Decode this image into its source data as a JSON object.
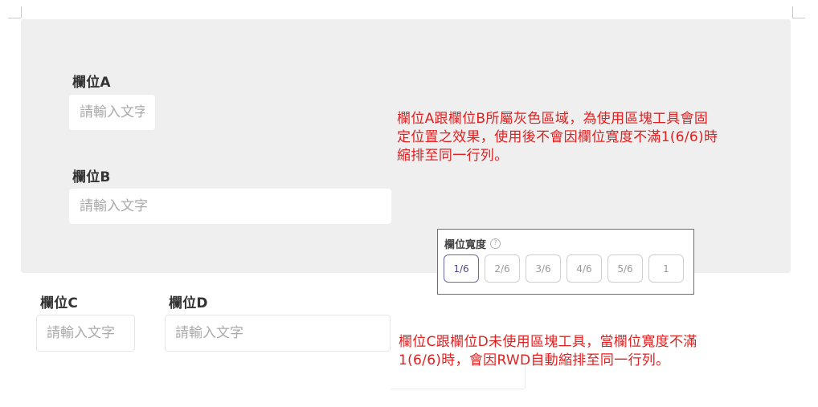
{
  "fields": {
    "a": {
      "label": "欄位A",
      "placeholder": "請輸入文字"
    },
    "b": {
      "label": "欄位B",
      "placeholder": "請輸入文字"
    },
    "c": {
      "label": "欄位C",
      "placeholder": "請輸入文字"
    },
    "d": {
      "label": "欄位D",
      "placeholder": "請輸入文字"
    }
  },
  "annotations": {
    "top": {
      "line1": "欄位A跟欄位B所屬灰色區域，為使用區塊工具會固",
      "line2": "定位置之效果，使用後不會因欄位寬度不滿1(6/6)時",
      "line3": "縮排至同一行列。"
    },
    "bottom": {
      "line1": "欄位C跟欄位D未使用區塊工具，當欄位寬度不滿",
      "line2": "1(6/6)時，會因RWD自動縮排至同一行列。"
    }
  },
  "width_panel": {
    "title": "欄位寬度",
    "help_icon": "question-circle-icon",
    "options": [
      "1/6",
      "2/6",
      "3/6",
      "4/6",
      "5/6",
      "1"
    ],
    "selected": "1/6"
  },
  "colors": {
    "annotation": "#e02020",
    "block_background": "#efefef",
    "active_option": "#6a6aa8"
  }
}
